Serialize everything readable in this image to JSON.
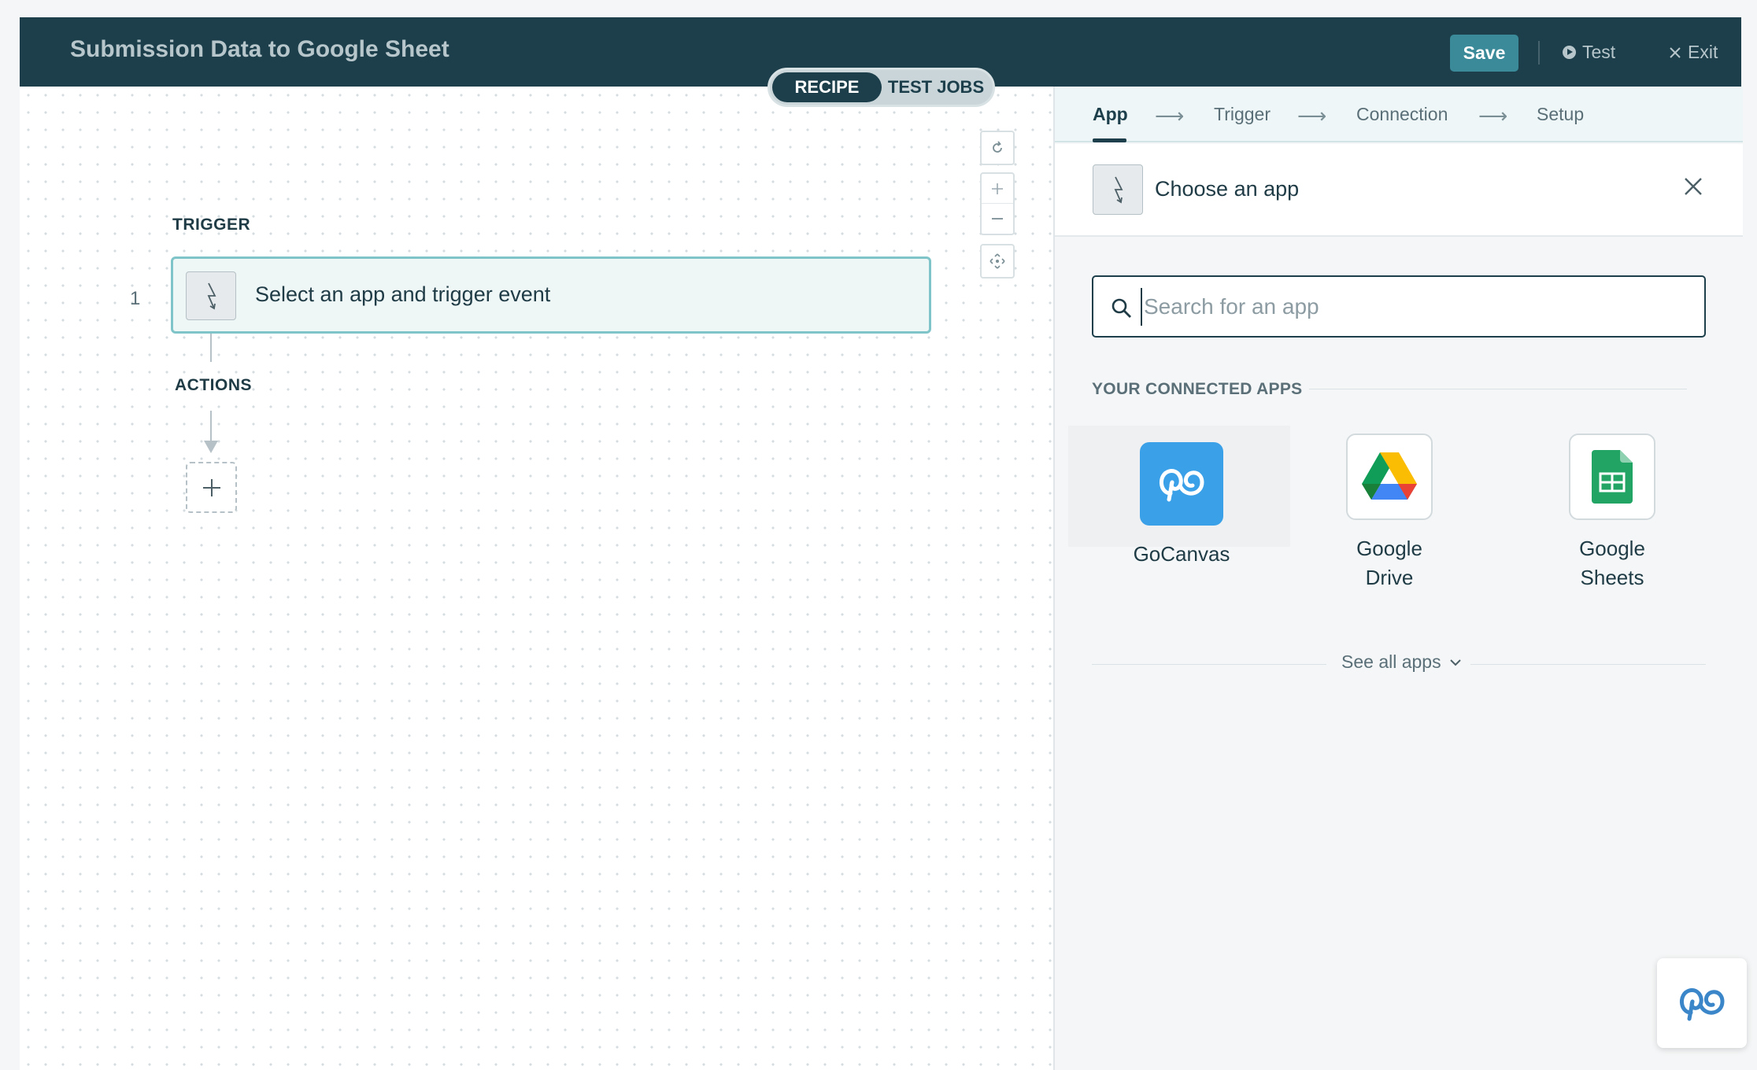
{
  "header": {
    "title": "Submission Data to Google Sheet",
    "save_label": "Save",
    "test_label": "Test",
    "exit_label": "Exit"
  },
  "mode_toggle": {
    "recipe_label": "RECIPE",
    "test_jobs_label": "TEST JOBS",
    "active": "RECIPE"
  },
  "recipe": {
    "trigger_heading": "TRIGGER",
    "step_number": "1",
    "trigger_placeholder": "Select an app and trigger event",
    "actions_heading": "ACTIONS"
  },
  "wizard": {
    "steps": [
      "App",
      "Trigger",
      "Connection",
      "Setup"
    ],
    "arrow": "⟶",
    "active": "App"
  },
  "choose_app": {
    "title": "Choose an app"
  },
  "search": {
    "placeholder": "Search for an app",
    "value": ""
  },
  "connected_apps": {
    "heading": "YOUR CONNECTED APPS",
    "apps": [
      {
        "name": "GoCanvas",
        "icon": "gocanvas-logo",
        "color": "#3aa0e8"
      },
      {
        "name": "Google Drive",
        "line1": "Google",
        "line2": "Drive",
        "icon": "google-drive-logo"
      },
      {
        "name": "Google Sheets",
        "line1": "Google",
        "line2": "Sheets",
        "icon": "google-sheets-logo",
        "color": "#21a464"
      }
    ],
    "see_all_label": "See all apps"
  },
  "colors": {
    "header_bg": "#1c3f4b",
    "accent": "#3a8a99",
    "trigger_border": "#7ec4c8"
  }
}
